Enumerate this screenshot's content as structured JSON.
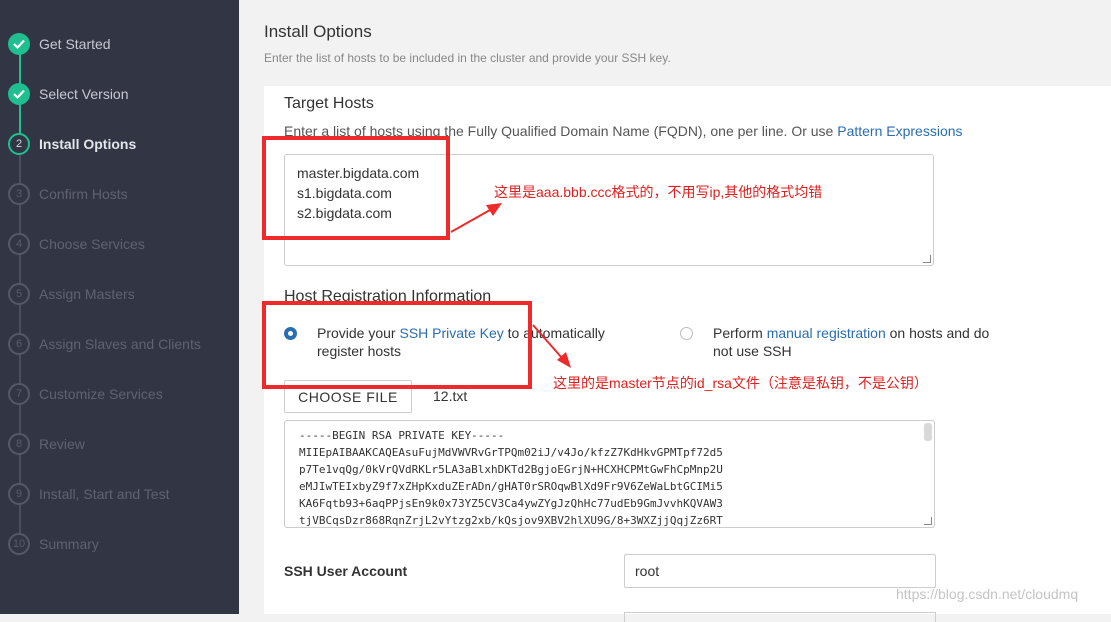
{
  "sidebar": {
    "steps": [
      {
        "num": "1",
        "label": "Get Started",
        "state": "done"
      },
      {
        "num": "2",
        "label": "Select Version",
        "state": "done"
      },
      {
        "num": "2",
        "label": "Install Options",
        "state": "current"
      },
      {
        "num": "3",
        "label": "Confirm Hosts",
        "state": "todo"
      },
      {
        "num": "4",
        "label": "Choose Services",
        "state": "todo"
      },
      {
        "num": "5",
        "label": "Assign Masters",
        "state": "todo"
      },
      {
        "num": "6",
        "label": "Assign Slaves and Clients",
        "state": "todo"
      },
      {
        "num": "7",
        "label": "Customize Services",
        "state": "todo"
      },
      {
        "num": "8",
        "label": "Review",
        "state": "todo"
      },
      {
        "num": "9",
        "label": "Install, Start and Test",
        "state": "todo"
      },
      {
        "num": "10",
        "label": "Summary",
        "state": "todo"
      }
    ]
  },
  "main": {
    "title": "Install Options",
    "subtitle": "Enter the list of hosts to be included in the cluster and provide your SSH key."
  },
  "target_hosts": {
    "title": "Target Hosts",
    "desc_prefix": "Enter a list of hosts using the Fully Qualified Domain Name (FQDN), one per line. Or use ",
    "desc_link": "Pattern Expressions",
    "hosts": [
      "master.bigdata.com",
      "s1.bigdata.com",
      "s2.bigdata.com"
    ]
  },
  "registration": {
    "title": "Host Registration Information",
    "option1_a": "Provide your ",
    "option1_link": "SSH Private Key",
    "option1_b": " to automatically",
    "option1_c": "register hosts",
    "option2_a": "Perform ",
    "option2_link": "manual registration",
    "option2_b": " on hosts and do",
    "option2_c": "not use SSH",
    "choose_file": "CHOOSE FILE",
    "file_name": "12.txt",
    "key_lines": [
      "-----BEGIN RSA PRIVATE KEY-----",
      "MIIEpAIBAAKCAQEAsuFujMdVWVRvGrTPQm02iJ/v4Jo/kfzZ7KdHkvGPMTpf72d5",
      "p7Te1vqQg/0kVrQVdRKLr5LA3aBlxhDKTd2BgjoEGrjN+HCXHCPMtGwFhCpMnp2U",
      "eMJIwTEIxbyZ9f7xZHpKxduZErADn/gHAT0rSROqwBlXd9Fr9V6ZeWaLbtGCIMi5",
      "KA6Fqtb93+6aqPPjsEn9k0x73YZ5CV3Ca4ywZYgJzQhHc77udEb9GmJvvhKQVAW3",
      "tjVBCqsDzr868RqnZrjL2vYtzg2xb/kQsjov9XBV2hlXU9G/8+3WXZjjQqjZz6RT"
    ],
    "ssh_user_label": "SSH User Account",
    "ssh_user_value": "root"
  },
  "annotations": {
    "note1": "这里是aaa.bbb.ccc格式的，不用写ip,其他的格式均错",
    "note2": "这里的是master节点的id_rsa文件（注意是私钥，不是公钥）",
    "color": "#ee2a2a"
  },
  "watermark": "https://blog.csdn.net/cloudmq",
  "colors": {
    "sidebar_bg": "#323544",
    "accent_green": "#1fbf8f",
    "link_blue": "#2a6db0"
  }
}
